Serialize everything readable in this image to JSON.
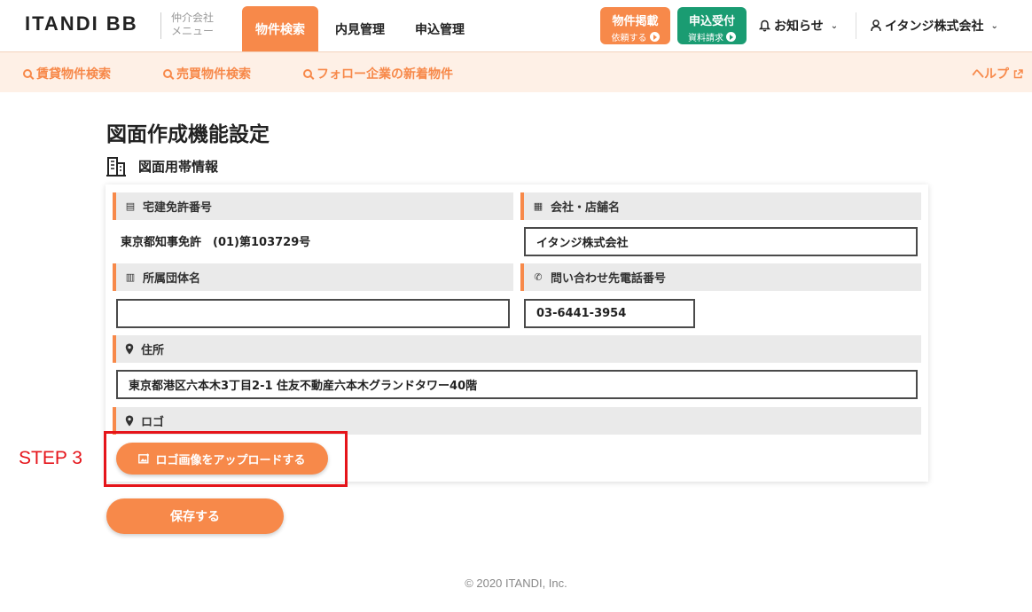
{
  "header": {
    "logo": "ITANDI BB",
    "menu_label_1": "仲介会社",
    "menu_label_2": "メニュー",
    "tabs": [
      {
        "label": "物件検索",
        "active": true
      },
      {
        "label": "内見管理",
        "active": false
      },
      {
        "label": "申込管理",
        "active": false
      }
    ],
    "listing_button": {
      "title": "物件掲載",
      "sub": "依頼する"
    },
    "apply_button": {
      "title": "申込受付",
      "sub": "資料請求"
    },
    "notice": "お知らせ",
    "account": "イタンジ株式会社",
    "colors": {
      "accent": "#f7894a",
      "green": "#1a9c72"
    }
  },
  "subnav": {
    "items": [
      "賃貸物件検索",
      "売買物件検索",
      "フォロー企業の新着物件"
    ],
    "help": "ヘルプ"
  },
  "page": {
    "title": "図面作成機能設定",
    "section": "図面用帯情報"
  },
  "form": {
    "license_label": "宅建免許番号",
    "license_value": "東京都知事免許　(01)第103729号",
    "company_label": "会社・店舗名",
    "company_value": "イタンジ株式会社",
    "org_label": "所属団体名",
    "org_value": "",
    "phone_label": "問い合わせ先電話番号",
    "phone_value": "03-6441-3954",
    "address_label": "住所",
    "address_value": "東京都港区六本木3丁目2-1 住友不動産六本木グランドタワー40階",
    "logo_label": "ロゴ",
    "upload_label": "ロゴ画像をアップロードする"
  },
  "annotation": {
    "step": "STEP 3"
  },
  "actions": {
    "save": "保存する"
  },
  "footer": {
    "copyright": "© 2020 ITANDI, Inc."
  }
}
